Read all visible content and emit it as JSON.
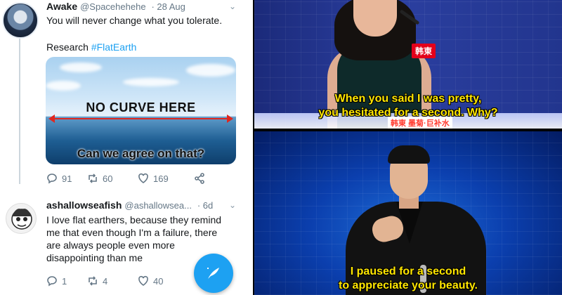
{
  "tweet1": {
    "name": "Awake",
    "handle": "@Spacehehehe",
    "date": "· 28 Aug",
    "text": "You will never change what you tolerate.",
    "research_prefix": "Research ",
    "hashtag": "#FlatEarth",
    "image": {
      "caption_top": "NO CURVE HERE",
      "caption_bottom": "Can we agree on that?"
    },
    "actions": {
      "replies": "91",
      "retweets": "60",
      "likes": "169"
    }
  },
  "tweet2": {
    "name": "ashallowseafish",
    "handle": "@ashallowsea...",
    "date": "· 6d",
    "lines": [
      "I love flat earthers, because they remind",
      "me that even though I'm a failure, there",
      "are always people even more",
      "disappointing than me"
    ],
    "actions": {
      "replies": "1",
      "retweets": "4",
      "likes": "40"
    }
  },
  "video_top": {
    "subtitle_lines": [
      "When you said I was pretty,",
      "you hesitated for a second. Why?"
    ],
    "badge": "韩東",
    "lower_third": "韩東 墨菊·巨补水"
  },
  "video_bottom": {
    "subtitle_lines": [
      "I paused for a second",
      "to appreciate your beauty."
    ]
  },
  "colors": {
    "twitter_blue": "#1da1f2",
    "subtitle_yellow": "#ffe600"
  },
  "icons": [
    "reply-icon",
    "retweet-icon",
    "like-icon",
    "share-icon",
    "compose-icon",
    "chevron-down-icon"
  ]
}
